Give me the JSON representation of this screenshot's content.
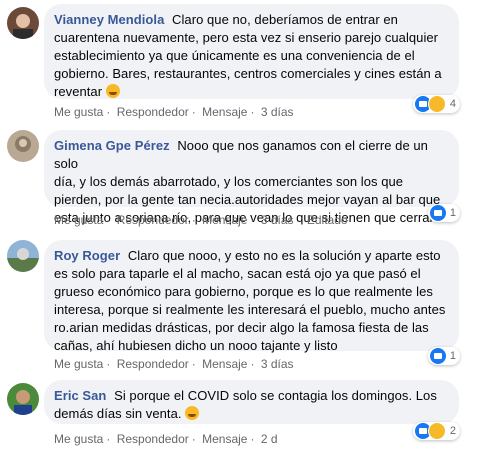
{
  "comments": [
    {
      "author": "Vianney Mendiola",
      "lines": [
        "Claro que no, deberíamos de entrar en",
        "cuarentena nuevamente, pero esta vez si enserio parejo cualquier",
        "establecimiento ya que únicamente es una conveniencia de el",
        "gobierno. Bares, restaurantes, centros comerciales y cines están a",
        "reventar"
      ],
      "emoji": "smiling-face",
      "actions": {
        "like": "Me gusta",
        "reply": "Respondedor",
        "message": "Mensaje",
        "time": "3 días",
        "edited": ""
      },
      "reaction_count": "4",
      "reaction_icons": [
        "like-icon",
        "haha-icon"
      ]
    },
    {
      "author": "Gimena Gpe Pérez",
      "lines": [
        "Nooo que nos ganamos con el cierre de un solo",
        "día, y los demás abarrotado, y los comerciantes son los que",
        "pierden, por la gente tan necia.autoridades mejor vayan al bar que",
        "esta junto a soriana río, para que vean lo que si tienen que cerrar"
      ],
      "emoji": "",
      "actions": {
        "like": "Me gusta",
        "reply": "Respondedor",
        "message": "Mensaje",
        "time": "3 días",
        "edited": "Editado"
      },
      "reaction_count": "1",
      "reaction_icons": [
        "like-icon"
      ]
    },
    {
      "author": "Roy Roger",
      "lines": [
        "Claro que nooo, y esto no es la solución y aparte esto",
        "es solo para taparle el al macho, sacan está ojo ya que pasó el",
        "grueso económico para gobierno, porque es lo que realmente les",
        "interesa, porque si realmente les interesará el pueblo, mucho antes",
        "ro.arian medidas drásticas, por decir algo la famosa fiesta de las",
        "cañas, ahí hubiesen dicho un nooo tajante y listo"
      ],
      "emoji": "",
      "actions": {
        "like": "Me gusta",
        "reply": "Respondedor",
        "message": "Mensaje",
        "time": "3 días",
        "edited": ""
      },
      "reaction_count": "1",
      "reaction_icons": [
        "like-icon"
      ]
    },
    {
      "author": "Eric San",
      "lines": [
        "Si porque el COVID solo se contagia los domingos. Los",
        "demás días sin venta."
      ],
      "emoji": "sad-face",
      "actions": {
        "like": "Me gusta",
        "reply": "Respondedor",
        "message": "Mensaje",
        "time": "2 d",
        "edited": ""
      },
      "reaction_count": "2",
      "reaction_icons": [
        "like-icon",
        "haha-icon"
      ]
    }
  ],
  "colors": {
    "name": "#385898",
    "bubble": "#f0f2f5",
    "meta": "#65676b",
    "like": "#1877f2",
    "haha": "#f7b928"
  }
}
